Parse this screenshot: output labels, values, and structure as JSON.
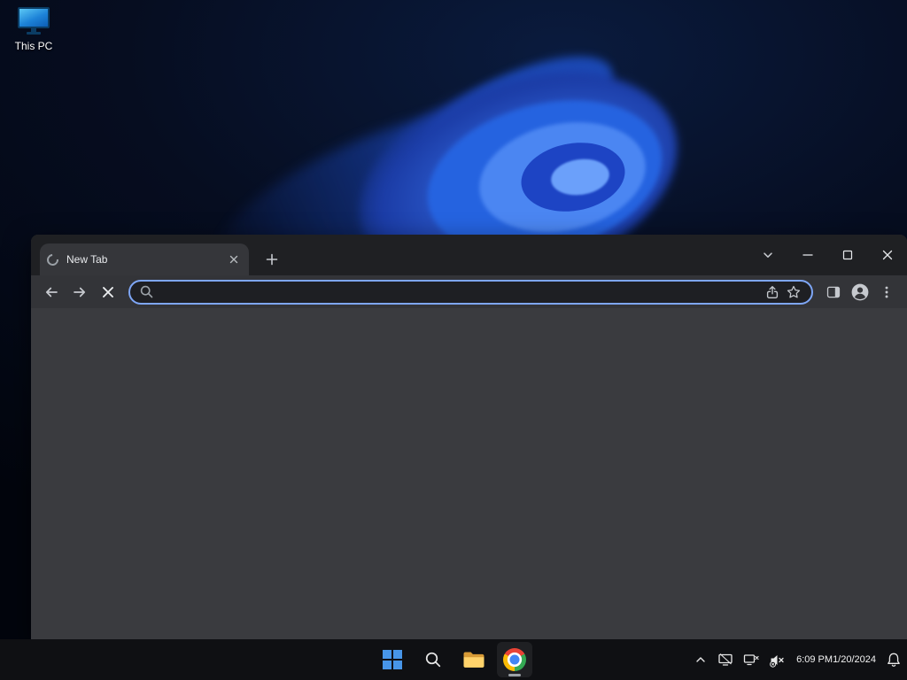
{
  "desktop": {
    "icons": [
      {
        "label": "This PC",
        "icon": "monitor-icon"
      }
    ]
  },
  "browser": {
    "tab": {
      "title": "New Tab",
      "favicon": "loading-spinner"
    },
    "omnibox": {
      "value": "",
      "placeholder": ""
    },
    "icons": {
      "tab_strip": [
        "loading-spinner",
        "tab-close",
        "new-tab-plus"
      ],
      "window_controls": [
        "tab-search-chevron-down",
        "minimize",
        "maximize",
        "close"
      ],
      "toolbar": [
        "back-arrow",
        "forward-arrow",
        "stop-x",
        "search",
        "share",
        "bookmark-star",
        "side-panel",
        "profile-avatar",
        "menu-dots"
      ]
    }
  },
  "taskbar": {
    "buttons": [
      "start",
      "search",
      "file-explorer",
      "chrome"
    ],
    "active_button": "chrome",
    "tray": {
      "time": "6:09 PM",
      "date": "1/20/2024",
      "icons": [
        "chevron-up",
        "display",
        "network-disconnected",
        "volume-muted",
        "notification-bell"
      ]
    }
  },
  "colors": {
    "omnibox_focus_ring": "#7ea6f6",
    "start_blue": "#4795e8",
    "chrome_red": "#ea4335",
    "chrome_yellow": "#fbbc05",
    "chrome_green": "#34a853",
    "chrome_blue": "#4285f4",
    "wallpaper_blue": "#2f6df6",
    "tabstrip_bg": "#1f2023",
    "toolbar_bg": "#333438",
    "content_bg": "#3a3b3f",
    "taskbar_bg": "#101114"
  }
}
